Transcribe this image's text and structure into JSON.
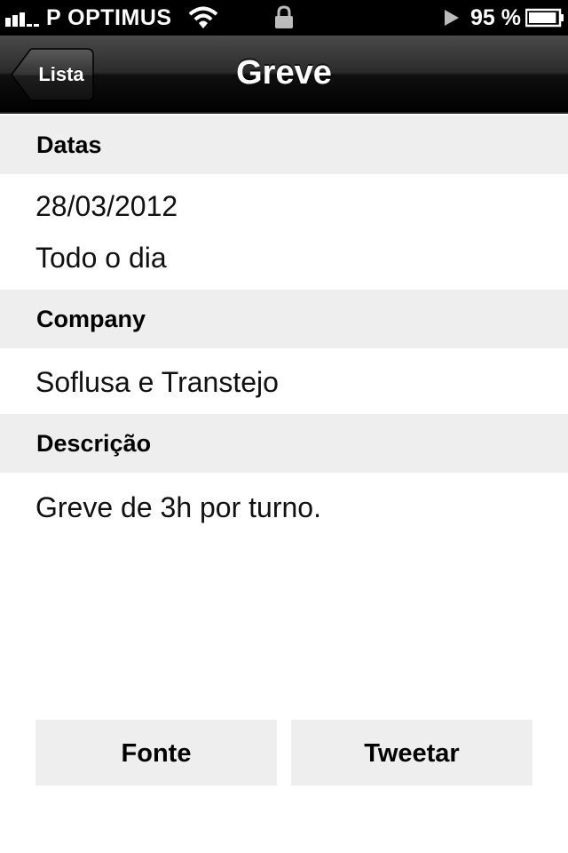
{
  "status_bar": {
    "carrier": "P OPTIMUS",
    "battery_percent": "95 %",
    "battery_level": 0.95,
    "icons": [
      "signal-icon",
      "wifi-icon",
      "lock-icon",
      "play-icon",
      "battery-icon"
    ]
  },
  "nav": {
    "back_label": "Lista",
    "title": "Greve"
  },
  "sections": {
    "dates": {
      "header": "Datas",
      "date": "28/03/2012",
      "time": "Todo o dia"
    },
    "company": {
      "header": "Company",
      "value": "Soflusa e Transtejo"
    },
    "description": {
      "header": "Descrição",
      "value": "Greve de 3h por turno."
    }
  },
  "actions": {
    "source_label": "Fonte",
    "tweet_label": "Tweetar"
  },
  "colors": {
    "section_bg": "#eeeeee",
    "status_bar_bg": "#000000",
    "text": "#000000"
  }
}
